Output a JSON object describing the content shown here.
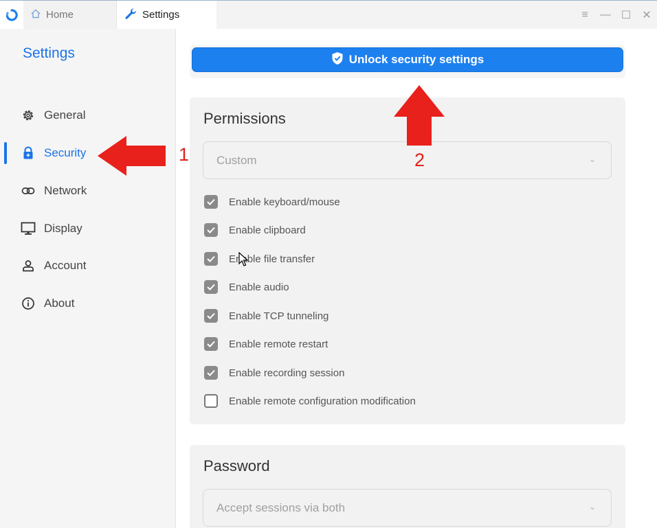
{
  "titlebar": {
    "tabs": [
      {
        "label": "Home",
        "icon": "home-icon"
      },
      {
        "label": "Settings",
        "icon": "wrench-icon"
      }
    ],
    "controls": [
      "menu-icon",
      "minimize-icon",
      "maximize-icon",
      "close-icon"
    ]
  },
  "sidebar": {
    "title": "Settings",
    "items": [
      {
        "label": "General",
        "icon": "gear-icon"
      },
      {
        "label": "Security",
        "icon": "lock-icon",
        "active": true
      },
      {
        "label": "Network",
        "icon": "link-icon"
      },
      {
        "label": "Display",
        "icon": "monitor-icon"
      },
      {
        "label": "Account",
        "icon": "person-icon"
      },
      {
        "label": "About",
        "icon": "info-icon"
      }
    ]
  },
  "main": {
    "unlock_label": "Unlock security settings",
    "permissions": {
      "title": "Permissions",
      "mode_value": "Custom",
      "options": [
        {
          "label": "Enable keyboard/mouse",
          "checked": true
        },
        {
          "label": "Enable clipboard",
          "checked": true
        },
        {
          "label": "Enable file transfer",
          "checked": true
        },
        {
          "label": "Enable audio",
          "checked": true
        },
        {
          "label": "Enable TCP tunneling",
          "checked": true
        },
        {
          "label": "Enable remote restart",
          "checked": true
        },
        {
          "label": "Enable recording session",
          "checked": true
        },
        {
          "label": "Enable remote configuration modification",
          "checked": false
        }
      ]
    },
    "password": {
      "title": "Password",
      "mode_value": "Accept sessions via both"
    }
  },
  "annotations": {
    "step1": "1",
    "step2": "2",
    "arrow_color": "#e0201b"
  },
  "colors": {
    "accent": "#1a73e8",
    "button": "#1d80ef"
  }
}
